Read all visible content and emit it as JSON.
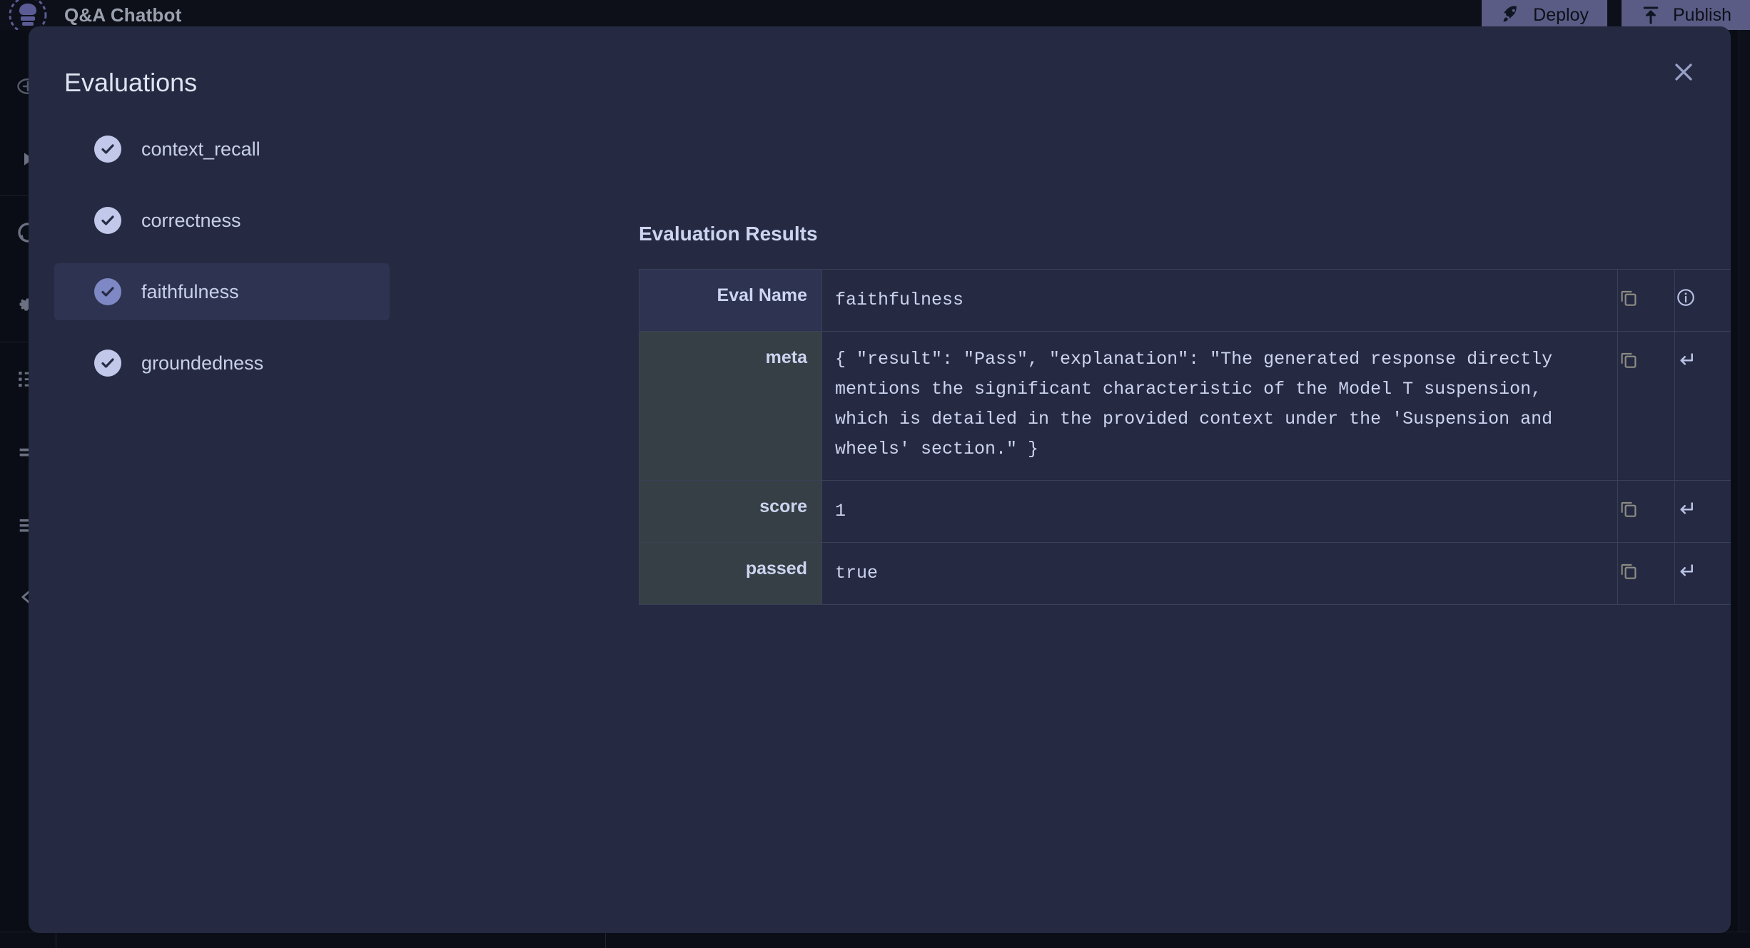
{
  "app": {
    "title": "Q&A Chatbot",
    "logo_icon": "chef-gear-logo-icon",
    "toolbar": [
      {
        "label": "Deploy",
        "icon": "rocket-icon"
      },
      {
        "label": "Publish",
        "icon": "upload-icon"
      }
    ],
    "rail_icons": [
      "plus-circle-icon",
      "play-icon",
      "refresh-icon",
      "gear-icon",
      "list-bullets-icon",
      "two-lines-icon",
      "align-lines-icon",
      "collapse-left-icon"
    ]
  },
  "modal": {
    "title": "Evaluations",
    "close_icon": "close-icon"
  },
  "eval_list": {
    "items": [
      {
        "label": "context_recall",
        "status_icon": "check-circle-icon",
        "selected": false
      },
      {
        "label": "correctness",
        "status_icon": "check-circle-icon",
        "selected": false
      },
      {
        "label": "faithfulness",
        "status_icon": "check-circle-icon",
        "selected": true
      },
      {
        "label": "groundedness",
        "status_icon": "check-circle-icon",
        "selected": false
      }
    ]
  },
  "results": {
    "heading": "Evaluation Results",
    "rows": [
      {
        "key": "Eval Name",
        "value": "faithfulness",
        "copy_icon": "copy-icon",
        "action_icon": "info-circle-icon"
      },
      {
        "key": "meta",
        "value": "{ \"result\": \"Pass\", \"explanation\": \"The generated response directly mentions the significant characteristic of the Model T suspension, which is detailed in the provided context under the 'Suspension and wheels' section.\" }",
        "copy_icon": "copy-icon",
        "action_icon": "return-arrow-icon"
      },
      {
        "key": "score",
        "value": "1",
        "copy_icon": "copy-icon",
        "action_icon": "return-arrow-icon"
      },
      {
        "key": "passed",
        "value": "true",
        "copy_icon": "copy-icon",
        "action_icon": "return-arrow-icon"
      }
    ]
  },
  "colors": {
    "modal_bg": "#252a42",
    "app_bg": "#0a0d16",
    "accent_check": "#c2c8ea",
    "accent_check_selected": "#7e88c4",
    "key_cell_bg": "#363f45",
    "toolbar_btn_bg": "#5b5c85"
  }
}
